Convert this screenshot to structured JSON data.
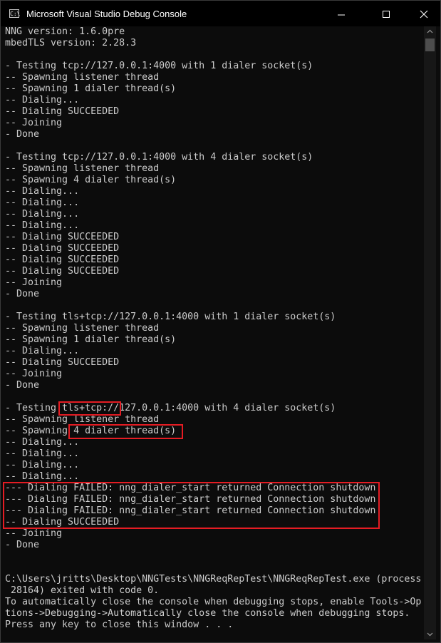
{
  "window": {
    "title": "Microsoft Visual Studio Debug Console",
    "icon_text": "C:\\"
  },
  "console": {
    "lines": [
      "NNG version: 1.6.0pre",
      "mbedTLS version: 2.28.3",
      "",
      "- Testing tcp://127.0.0.1:4000 with 1 dialer socket(s)",
      "-- Spawning listener thread",
      "-- Spawning 1 dialer thread(s)",
      "-- Dialing...",
      "-- Dialing SUCCEEDED",
      "-- Joining",
      "- Done",
      "",
      "- Testing tcp://127.0.0.1:4000 with 4 dialer socket(s)",
      "-- Spawning listener thread",
      "-- Spawning 4 dialer thread(s)",
      "-- Dialing...",
      "-- Dialing...",
      "-- Dialing...",
      "-- Dialing...",
      "-- Dialing SUCCEEDED",
      "-- Dialing SUCCEEDED",
      "-- Dialing SUCCEEDED",
      "-- Dialing SUCCEEDED",
      "-- Joining",
      "- Done",
      "",
      "- Testing tls+tcp://127.0.0.1:4000 with 1 dialer socket(s)",
      "-- Spawning listener thread",
      "-- Spawning 1 dialer thread(s)",
      "-- Dialing...",
      "-- Dialing SUCCEEDED",
      "-- Joining",
      "- Done",
      "",
      "- Testing tls+tcp://127.0.0.1:4000 with 4 dialer socket(s)",
      "-- Spawning listener thread",
      "-- Spawning 4 dialer thread(s)",
      "-- Dialing...",
      "-- Dialing...",
      "-- Dialing...",
      "-- Dialing...",
      "--- Dialing FAILED: nng_dialer_start returned Connection shutdown",
      "--- Dialing FAILED: nng_dialer_start returned Connection shutdown",
      "--- Dialing FAILED: nng_dialer_start returned Connection shutdown",
      "-- Dialing SUCCEEDED",
      "-- Joining",
      "- Done",
      "",
      "",
      "C:\\Users\\jritts\\Desktop\\NNGTests\\NNGReqRepTest\\NNGReqRepTest.exe (process",
      " 28164) exited with code 0.",
      "To automatically close the console when debugging stops, enable Tools->Op",
      "tions->Debugging->Automatically close the console when debugging stops.",
      "Press any key to close this window . . ."
    ]
  },
  "colors": {
    "console_bg": "#0c0c0c",
    "console_text": "#cccccc",
    "highlight": "#e51c23"
  }
}
